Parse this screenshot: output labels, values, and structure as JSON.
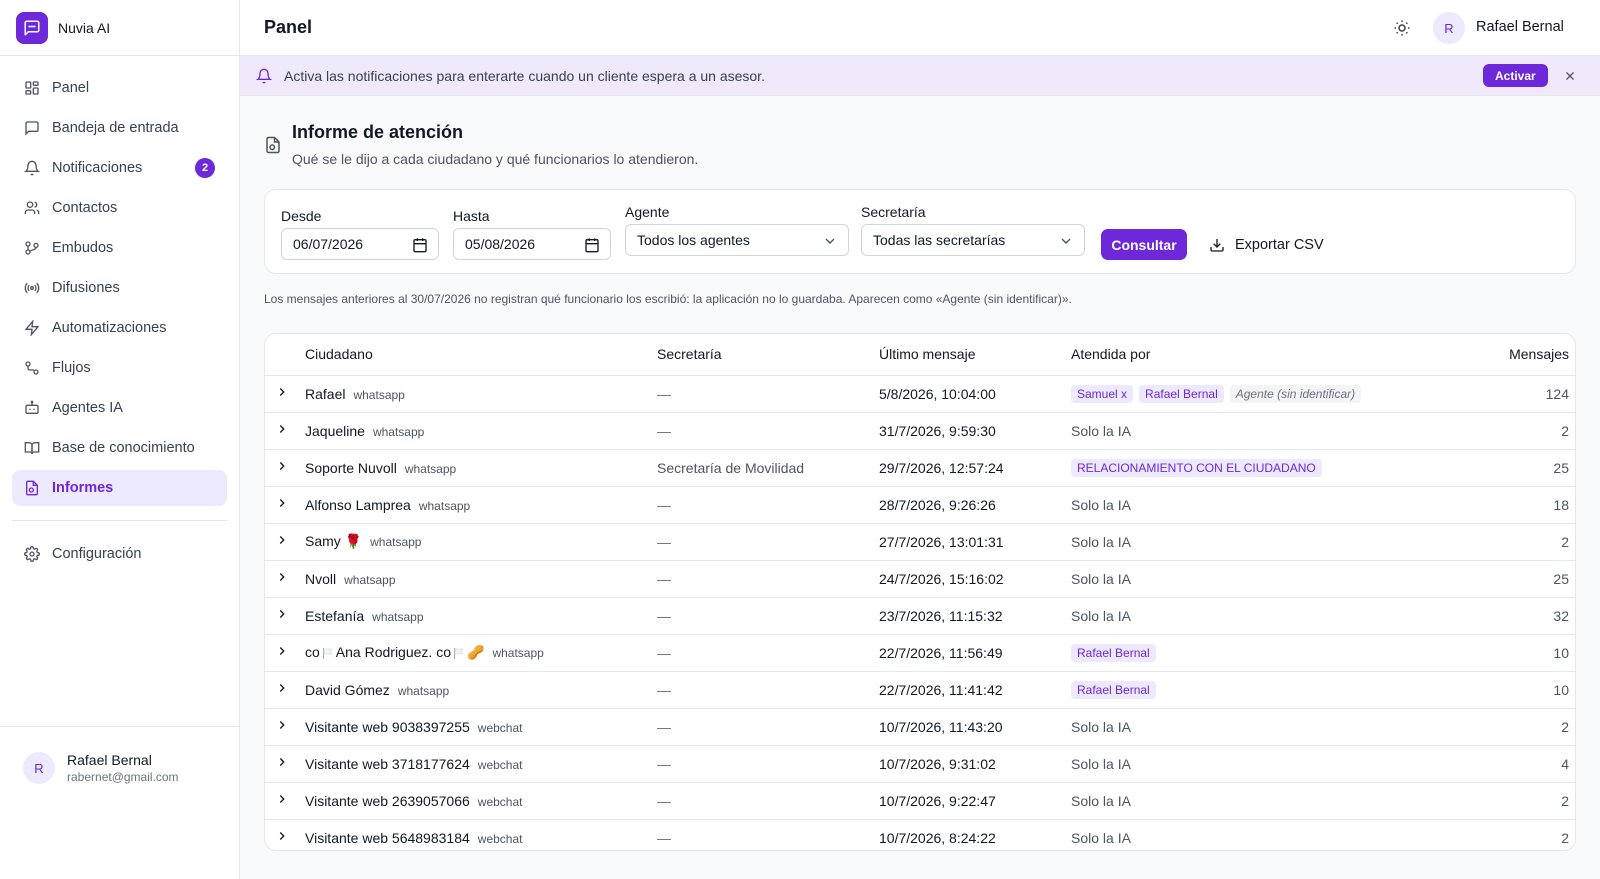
{
  "app": {
    "name": "Nuvia AI",
    "brand_color": "#6d28d9"
  },
  "sidebar": {
    "items": [
      {
        "label": "Panel",
        "icon": "layout-grid-icon"
      },
      {
        "label": "Bandeja de entrada",
        "icon": "message-square-icon"
      },
      {
        "label": "Notificaciones",
        "icon": "bell-icon",
        "badge": "2"
      },
      {
        "label": "Contactos",
        "icon": "users-icon"
      },
      {
        "label": "Embudos",
        "icon": "git-branch-icon"
      },
      {
        "label": "Difusiones",
        "icon": "radio-icon"
      },
      {
        "label": "Automatizaciones",
        "icon": "zap-icon"
      },
      {
        "label": "Flujos",
        "icon": "workflow-icon"
      },
      {
        "label": "Agentes IA",
        "icon": "bot-icon"
      },
      {
        "label": "Base de conocimiento",
        "icon": "book-open-icon"
      },
      {
        "label": "Informes",
        "icon": "file-chart-icon",
        "active": true
      }
    ],
    "settings": {
      "label": "Configuración",
      "icon": "settings-icon"
    },
    "user": {
      "initial": "R",
      "name": "Rafael Bernal",
      "email": "rabernet@gmail.com"
    }
  },
  "topbar": {
    "title": "Panel",
    "user_initial": "R",
    "user_name": "Rafael Bernal"
  },
  "banner": {
    "text": "Activa las notificaciones para enterarte cuando un cliente espera a un asesor.",
    "button": "Activar"
  },
  "report": {
    "title": "Informe de atención",
    "subtitle": "Qué se le dijo a cada ciudadano y qué funcionarios lo atendieron."
  },
  "filters": {
    "desde_label": "Desde",
    "desde_value": "06/07/2026",
    "hasta_label": "Hasta",
    "hasta_value": "05/08/2026",
    "agente_label": "Agente",
    "agente_value": "Todos los agentes",
    "secretaria_label": "Secretaría",
    "secretaria_value": "Todas las secretarías",
    "consultar": "Consultar",
    "exportar": "Exportar CSV"
  },
  "note": "Los mensajes anteriores al 30/07/2026 no registran qué funcionario los escribió: la aplicación no lo guardaba. Aparecen como «Agente (sin identificar)».",
  "table": {
    "headers": {
      "ciudadano": "Ciudadano",
      "secretaria": "Secretaría",
      "ultimo": "Último mensaje",
      "atendida": "Atendida por",
      "mensajes": "Mensajes"
    },
    "rows": [
      {
        "name": "Rafael",
        "channel": "whatsapp",
        "secretaria": "—",
        "ultimo": "5/8/2026, 10:04:00",
        "pills": [
          {
            "text": "Samuel x",
            "style": "purple"
          },
          {
            "text": "Rafael Bernal",
            "style": "purple"
          },
          {
            "text": "Agente (sin identificar)",
            "style": "gray"
          }
        ],
        "mensajes": "124"
      },
      {
        "name": "Jaqueline",
        "channel": "whatsapp",
        "secretaria": "—",
        "ultimo": "31/7/2026, 9:59:30",
        "atendida": "Solo la IA",
        "mensajes": "2"
      },
      {
        "name": "Soporte Nuvoll",
        "channel": "whatsapp",
        "secretaria": "Secretaría de Movilidad",
        "ultimo": "29/7/2026, 12:57:24",
        "pills": [
          {
            "text": "RELACIONAMIENTO CON EL CIUDADANO",
            "style": "purple"
          }
        ],
        "mensajes": "25"
      },
      {
        "name": "Alfonso Lamprea",
        "channel": "whatsapp",
        "secretaria": "—",
        "ultimo": "28/7/2026, 9:26:26",
        "atendida": "Solo la IA",
        "mensajes": "18"
      },
      {
        "name": "Samy 🌹",
        "channel": "whatsapp",
        "secretaria": "—",
        "ultimo": "27/7/2026, 13:01:31",
        "atendida": "Solo la IA",
        "mensajes": "2"
      },
      {
        "name": "Nvoll",
        "channel": "whatsapp",
        "secretaria": "—",
        "ultimo": "24/7/2026, 15:16:02",
        "atendida": "Solo la IA",
        "mensajes": "25"
      },
      {
        "name": "Estefanía",
        "channel": "whatsapp",
        "secretaria": "—",
        "ultimo": "23/7/2026, 11:15:32",
        "atendida": "Solo la IA",
        "mensajes": "32"
      },
      {
        "name_parts": [
          "co",
          "Ana Rodriguez.",
          "co",
          "🥜"
        ],
        "name": "co 🏳 Ana Rodriguez. co 🏳 🥜",
        "channel": "whatsapp",
        "secretaria": "—",
        "ultimo": "22/7/2026, 11:56:49",
        "pills": [
          {
            "text": "Rafael Bernal",
            "style": "purple"
          }
        ],
        "mensajes": "10"
      },
      {
        "name": "David Gómez",
        "channel": "whatsapp",
        "secretaria": "—",
        "ultimo": "22/7/2026, 11:41:42",
        "pills": [
          {
            "text": "Rafael Bernal",
            "style": "purple"
          }
        ],
        "mensajes": "10"
      },
      {
        "name": "Visitante web 9038397255",
        "channel": "webchat",
        "secretaria": "—",
        "ultimo": "10/7/2026, 11:43:20",
        "atendida": "Solo la IA",
        "mensajes": "2"
      },
      {
        "name": "Visitante web 3718177624",
        "channel": "webchat",
        "secretaria": "—",
        "ultimo": "10/7/2026, 9:31:02",
        "atendida": "Solo la IA",
        "mensajes": "4"
      },
      {
        "name": "Visitante web 2639057066",
        "channel": "webchat",
        "secretaria": "—",
        "ultimo": "10/7/2026, 9:22:47",
        "atendida": "Solo la IA",
        "mensajes": "2"
      },
      {
        "name": "Visitante web 5648983184",
        "channel": "webchat",
        "secretaria": "—",
        "ultimo": "10/7/2026, 8:24:22",
        "atendida": "Solo la IA",
        "mensajes": "2"
      }
    ]
  }
}
